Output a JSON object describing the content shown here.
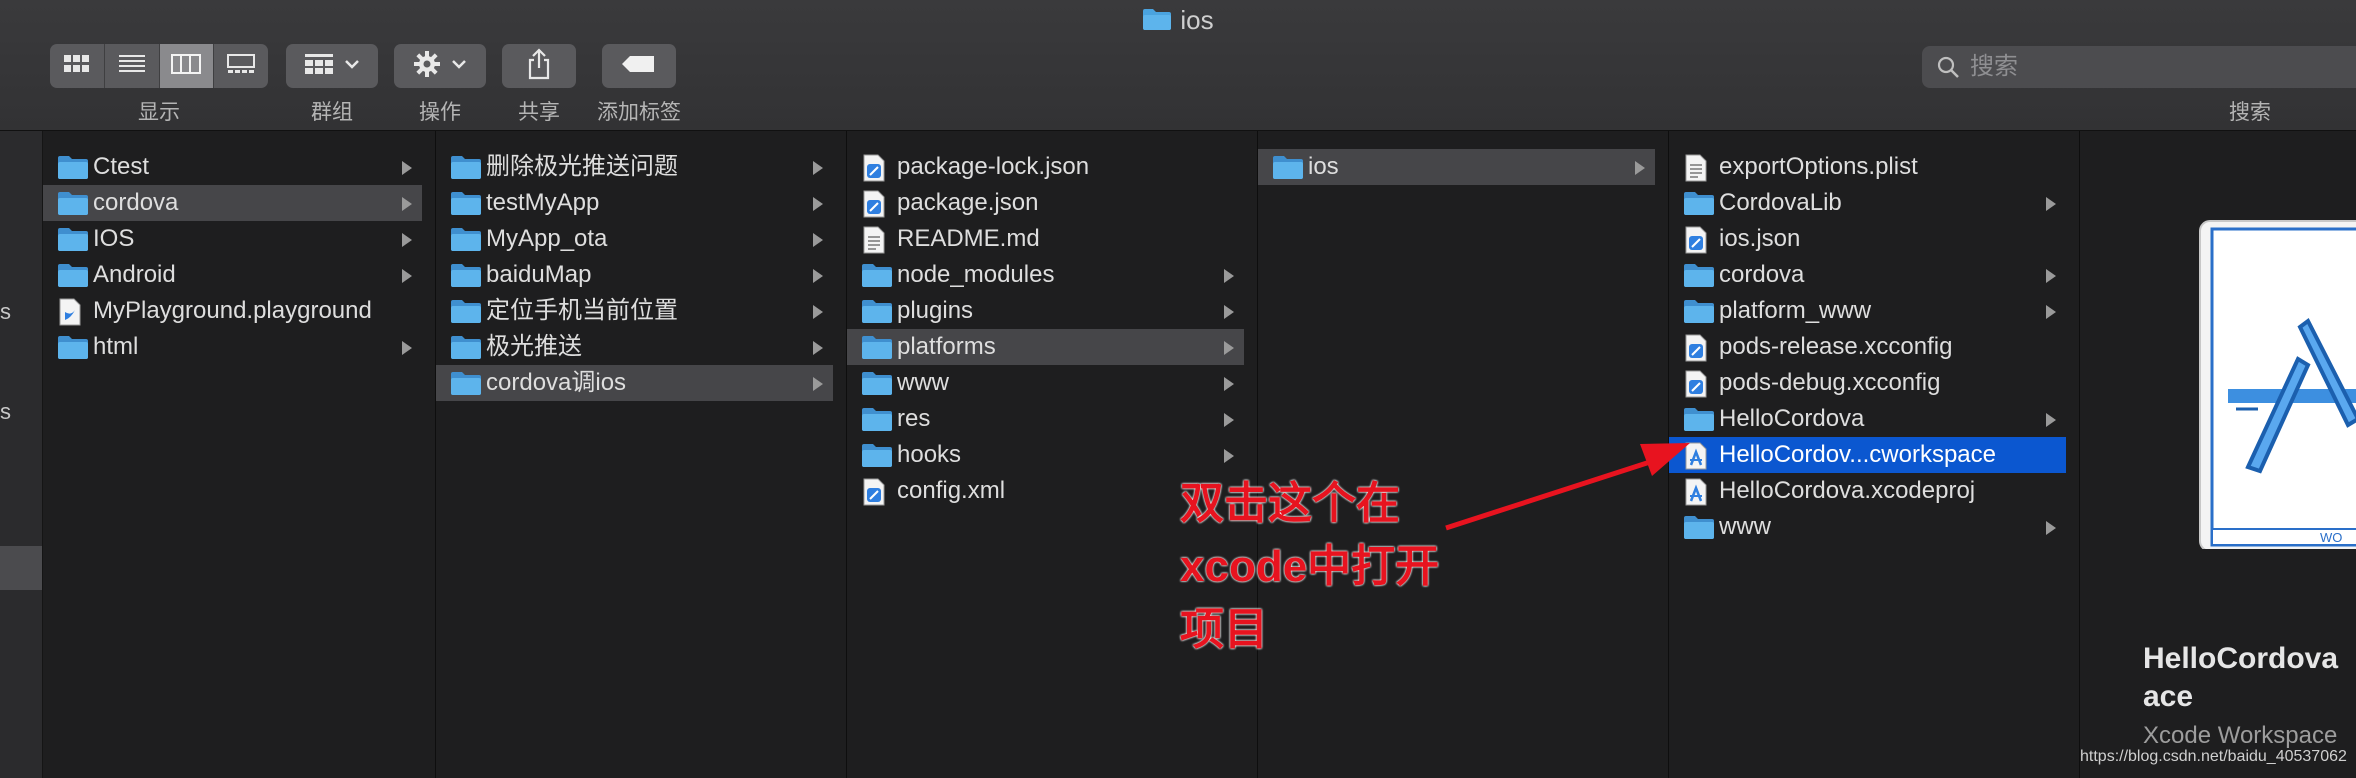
{
  "window": {
    "title": "ios"
  },
  "toolbar": {
    "view_label": "显示",
    "group_label": "群组",
    "action_label": "操作",
    "share_label": "共享",
    "tags_label": "添加标签",
    "search_placeholder": "搜索",
    "search_label": "搜索"
  },
  "columns": [
    {
      "items": [
        {
          "name": "Ctest",
          "icon": "folder-icon",
          "arrow": true
        },
        {
          "name": "cordova",
          "icon": "folder-icon",
          "arrow": true,
          "selected": true
        },
        {
          "name": "IOS",
          "icon": "folder-icon",
          "arrow": true
        },
        {
          "name": "Android",
          "icon": "folder-icon",
          "arrow": true
        },
        {
          "name": "MyPlayground.playground",
          "icon": "playground-file-icon",
          "arrow": false
        },
        {
          "name": "html",
          "icon": "folder-icon",
          "arrow": true
        }
      ]
    },
    {
      "items": [
        {
          "name": "删除极光推送问题",
          "icon": "folder-icon",
          "arrow": true
        },
        {
          "name": "testMyApp",
          "icon": "folder-icon",
          "arrow": true
        },
        {
          "name": "MyApp_ota",
          "icon": "folder-icon",
          "arrow": true
        },
        {
          "name": "baiduMap",
          "icon": "folder-icon",
          "arrow": true
        },
        {
          "name": "定位手机当前位置",
          "icon": "folder-icon",
          "arrow": true
        },
        {
          "name": "极光推送",
          "icon": "folder-icon",
          "arrow": true
        },
        {
          "name": "cordova调ios",
          "icon": "folder-icon",
          "arrow": true,
          "selected": true
        }
      ]
    },
    {
      "items": [
        {
          "name": "package-lock.json",
          "icon": "code-file-icon",
          "arrow": false
        },
        {
          "name": "package.json",
          "icon": "code-file-icon",
          "arrow": false
        },
        {
          "name": "README.md",
          "icon": "text-file-icon",
          "arrow": false
        },
        {
          "name": "node_modules",
          "icon": "folder-icon",
          "arrow": true
        },
        {
          "name": "plugins",
          "icon": "folder-icon",
          "arrow": true
        },
        {
          "name": "platforms",
          "icon": "folder-icon",
          "arrow": true,
          "selected": true
        },
        {
          "name": "www",
          "icon": "folder-icon",
          "arrow": true
        },
        {
          "name": "res",
          "icon": "folder-icon",
          "arrow": true
        },
        {
          "name": "hooks",
          "icon": "folder-icon",
          "arrow": true
        },
        {
          "name": "config.xml",
          "icon": "code-file-icon",
          "arrow": false
        }
      ]
    },
    {
      "items": [
        {
          "name": "ios",
          "icon": "folder-icon",
          "arrow": true,
          "selected": true
        }
      ]
    },
    {
      "items": [
        {
          "name": "exportOptions.plist",
          "icon": "text-file-icon",
          "arrow": false
        },
        {
          "name": "CordovaLib",
          "icon": "folder-icon",
          "arrow": true
        },
        {
          "name": "ios.json",
          "icon": "code-file-icon",
          "arrow": false
        },
        {
          "name": "cordova",
          "icon": "folder-icon",
          "arrow": true
        },
        {
          "name": "platform_www",
          "icon": "folder-icon",
          "arrow": true
        },
        {
          "name": "pods-release.xcconfig",
          "icon": "code-file-icon",
          "arrow": false
        },
        {
          "name": "pods-debug.xcconfig",
          "icon": "code-file-icon",
          "arrow": false
        },
        {
          "name": "HelloCordova",
          "icon": "folder-icon",
          "arrow": true
        },
        {
          "name": "HelloCordov...cworkspace",
          "icon": "xcode-workspace-icon",
          "arrow": false,
          "active": true
        },
        {
          "name": "HelloCordova.xcodeproj",
          "icon": "xcode-project-icon",
          "arrow": false
        },
        {
          "name": "www",
          "icon": "folder-icon",
          "arrow": true
        }
      ]
    }
  ],
  "preview": {
    "name": "HelloCordova.xcworkspace",
    "name_display": "HelloCordova\nace",
    "kind": "Xcode Workspace",
    "icon_caption": "WO"
  },
  "annotation": {
    "lines": [
      "双击这个在",
      "xcode中打开",
      "项目"
    ],
    "color": "#e8131f"
  },
  "watermark": "https://blog.csdn.net/baidu_40537062",
  "colors": {
    "folder": "#4aa3df",
    "selection_active": "#0b57d0",
    "selection_inactive": "#464649"
  }
}
